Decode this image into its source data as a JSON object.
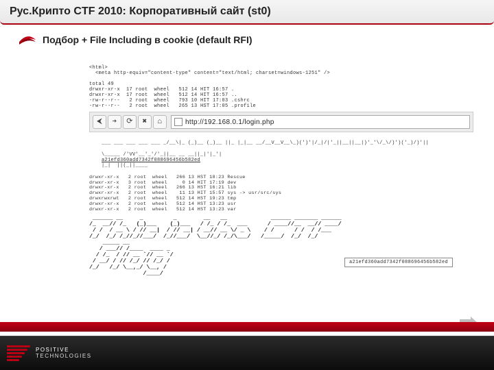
{
  "header": {
    "title": "Рус.Крипто CTF 2010: Корпоративный сайт (st0)"
  },
  "subheader": {
    "text": "Подбор + File Including в cookie (default RFI)"
  },
  "browser": {
    "back": "⮜",
    "forward": "➔",
    "reload": "⟳",
    "stop": "✖",
    "home": "⌂",
    "url": "http://192.168.0.1/login.php"
  },
  "terminal": {
    "top_block": "<html>\n  <meta http-equiv=\"content-type\" content=\"text/html; charset=windows-1251\" />\n\ntotal 49\ndrwxr-xr-x  17 root  wheel   512 14 HIT 16:57 .\ndrwxr-xr-x  17 root  wheel   512 14 HIT 16:57 ..\n-rw-r--r--   2 root  wheel   793 10 HIT 17:03 .cshrc\n-rw-r--r--   2 root  wheel   265 13 HST 17:05 .profile",
    "ascii_banner1": "___ ___ ___ ___ ___ _/__\\|_ (_)__ (_)__ ||_ |_|__ __/__V__V__\\_)(')'|/_|/|'_||__||__|)'_'\\/_\\/)')('_)/)'||",
    "ascii_banner2": "\\_____ /'VV'__'_'/'_||__ __ __||_|'|_'|",
    "hash1": "a21efd360add7342f088696456b582ed",
    "ascii_banner_tail": "|_|  ||(_||____",
    "mid_block": "drwxr-xr-x   2 root  wheel   266 13 HST 18:23 Rescue\ndrwxr-xr-x   3 root  wheel     0 14 HIT 17:19 dev\ndrwxr-xr-x   2 root  wheel   266 13 HST 16:21 lib\ndrwxr-xr-x   2 root  wheel    11 13 HIT 15:57 sys -> usr/src/sys\ndrwxrwxrwt   2 root  wheel   512 14 HST 19:23 tmp\ndrwxr-xr-x   2 root  wheel   512 14 HST 13:23 usr\ndrwxr-xr-x   2 root  wheel   512 14 HST 13:23 var",
    "flag_art": " ______ __     _         _        __   __             ______ _______ ______\n/_  __// /_   (_)___    (_)___   / /_ / /_  ___      / ____//__  __// ____/\n / /  / __ \\ / // __|  / // __| / __// __ \\/ _ \\    / /      / /  / /___\n/_/  /_/ /_//_//___/  /_//___/  \\__//_/ /_/\\___/   /_____/  /_/  /_/    \n    _____ __\n   / ___// /____  ____ _\n  / /_  / // __ `// __ `/\n / __/ / // /_/ // /_/ /\n/_/   /_/ \\__,_/ \\__, /\n                /____/",
    "flag_hash": "a21efd360add7342f088696456b582ed"
  },
  "footer": {
    "brand_top": "POSITIVE",
    "brand_bottom": "TECHNOLOGIES"
  },
  "nav": {
    "next": "➜"
  }
}
